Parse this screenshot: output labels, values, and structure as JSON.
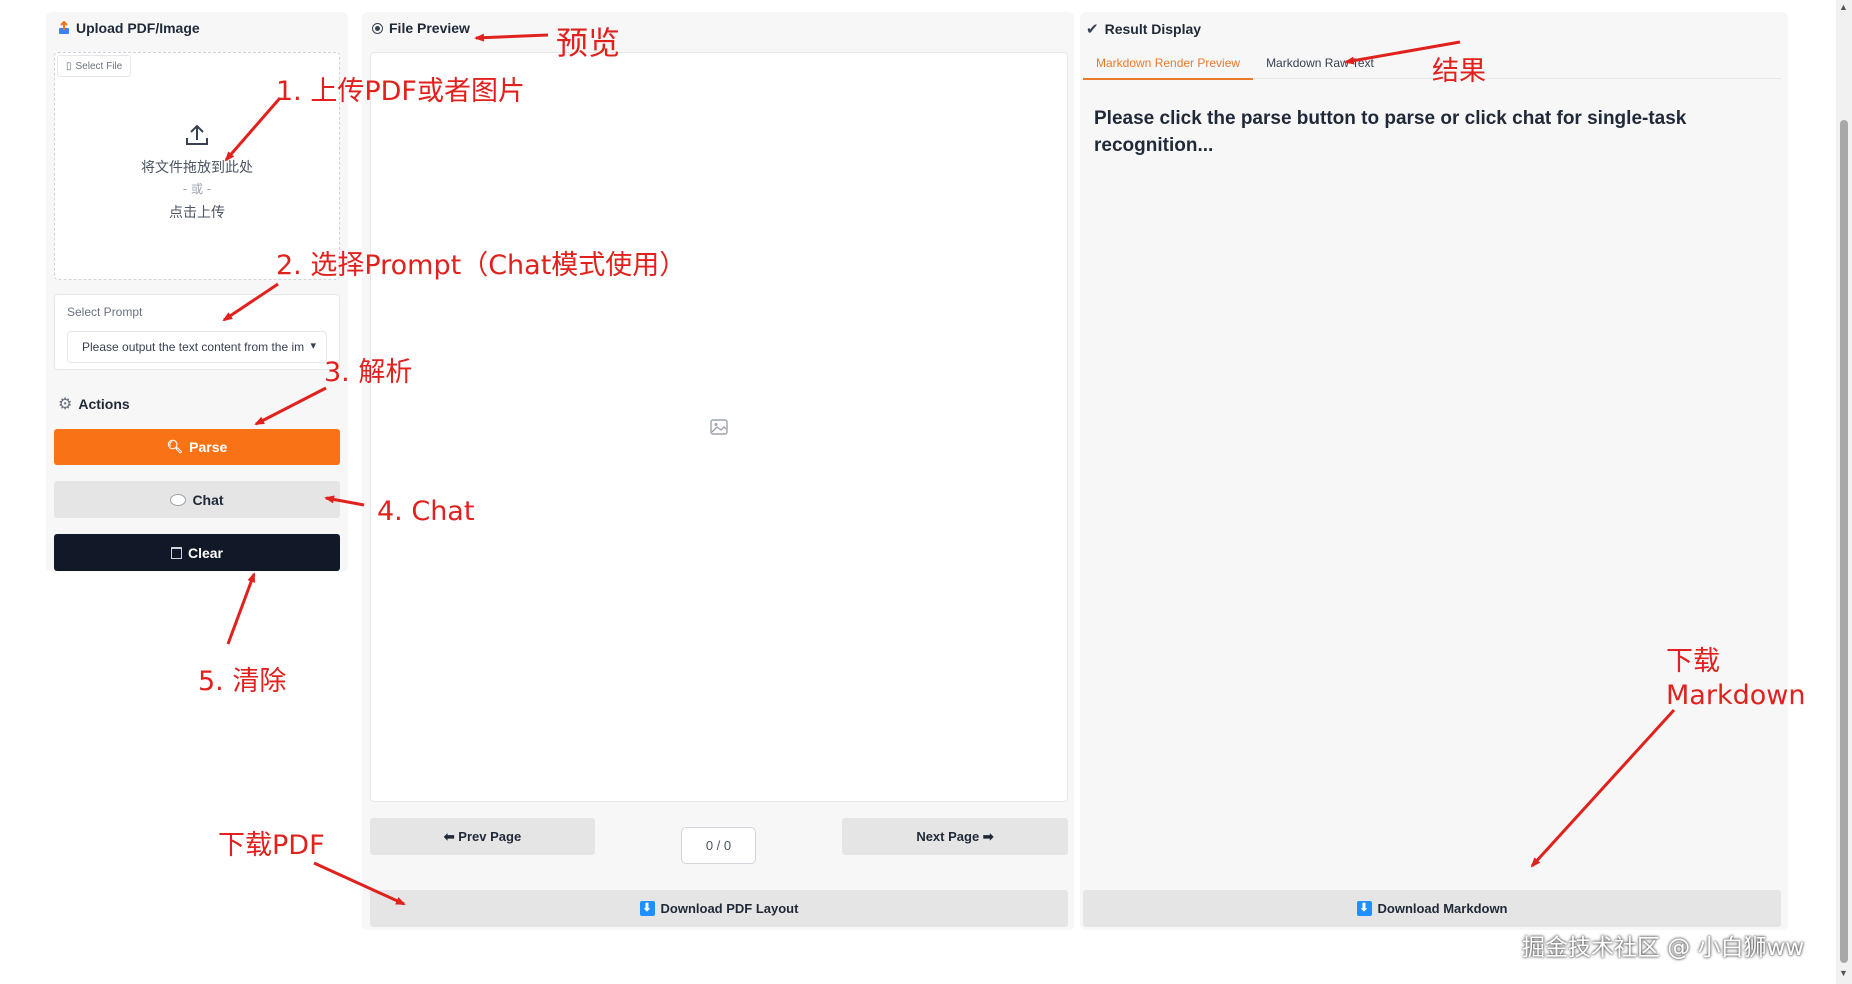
{
  "upload": {
    "title": "Upload PDF/Image",
    "select_file_tab": "Select File",
    "drop_text": "将文件拖放到此处",
    "or_text": "- 或 -",
    "click_text": "点击上传"
  },
  "prompt": {
    "label": "Select Prompt",
    "value": "Please output the text content from the image"
  },
  "actions": {
    "label": "Actions",
    "parse": "Parse",
    "chat": "Chat",
    "clear": "Clear"
  },
  "preview": {
    "title": "File Preview",
    "prev": "⬅ Prev Page",
    "next": "Next Page ➡",
    "page_counter": "0 / 0",
    "download_pdf": "Download PDF Layout"
  },
  "result": {
    "title": "Result Display",
    "tabs": [
      "Markdown Render Preview",
      "Markdown Raw Text"
    ],
    "active_tab": 0,
    "placeholder": "Please click the parse button to parse or click chat for single-task recognition...",
    "download_md": "Download Markdown"
  },
  "annotations": {
    "a1": "1. 上传PDF或者图片",
    "a2": "2. 选择Prompt（Chat模式使用）",
    "a3": "3. 解析",
    "a4": "4. Chat",
    "a5": "5. 清除",
    "preview": "预览",
    "result": "结果",
    "dl_pdf": "下载PDF",
    "dl_md_line1": "下载",
    "dl_md_line2": "Markdown"
  },
  "watermark": "掘金技术社区 @ 小白狮ww",
  "colors": {
    "accent": "#f97316",
    "dark_button": "#111827",
    "annotation": "#e0211d",
    "download_icon": "#1e90ff"
  }
}
